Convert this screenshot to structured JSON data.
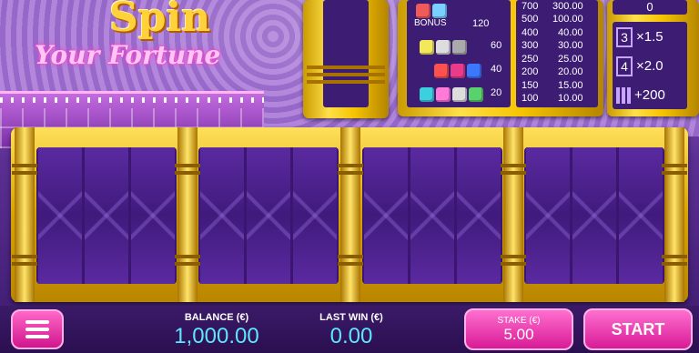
{
  "logo": {
    "line1": "Spin",
    "line2": "Your Fortune"
  },
  "paytable": {
    "dice_rows": [
      {
        "label": "BONUS",
        "value": "120"
      },
      {
        "label": "",
        "value": "60"
      },
      {
        "label": "",
        "value": "40"
      },
      {
        "label": "",
        "value": "20"
      }
    ],
    "prize_rows": [
      {
        "score": "700",
        "prize": "300.00"
      },
      {
        "score": "500",
        "prize": "100.00"
      },
      {
        "score": "400",
        "prize": "40.00"
      },
      {
        "score": "300",
        "prize": "30.00"
      },
      {
        "score": "250",
        "prize": "25.00"
      },
      {
        "score": "200",
        "prize": "20.00"
      },
      {
        "score": "150",
        "prize": "15.00"
      },
      {
        "score": "100",
        "prize": "10.00"
      }
    ]
  },
  "side": {
    "top_value": "0",
    "mult3_box": "3",
    "mult3_text": "×1.5",
    "mult4_box": "4",
    "mult4_text": "×2.0",
    "grid_text": "+200"
  },
  "bottom": {
    "balance_label": "BALANCE (€)",
    "balance_value": "1,000.00",
    "lastwin_label": "LAST WIN (€)",
    "lastwin_value": "0.00",
    "stake_label": "STAKE (€)",
    "stake_value": "5.00",
    "start_label": "START"
  },
  "colors": {
    "accent_pink": "#e0249e",
    "value_cyan": "#5ee6ff",
    "gold": "#f6c400"
  }
}
